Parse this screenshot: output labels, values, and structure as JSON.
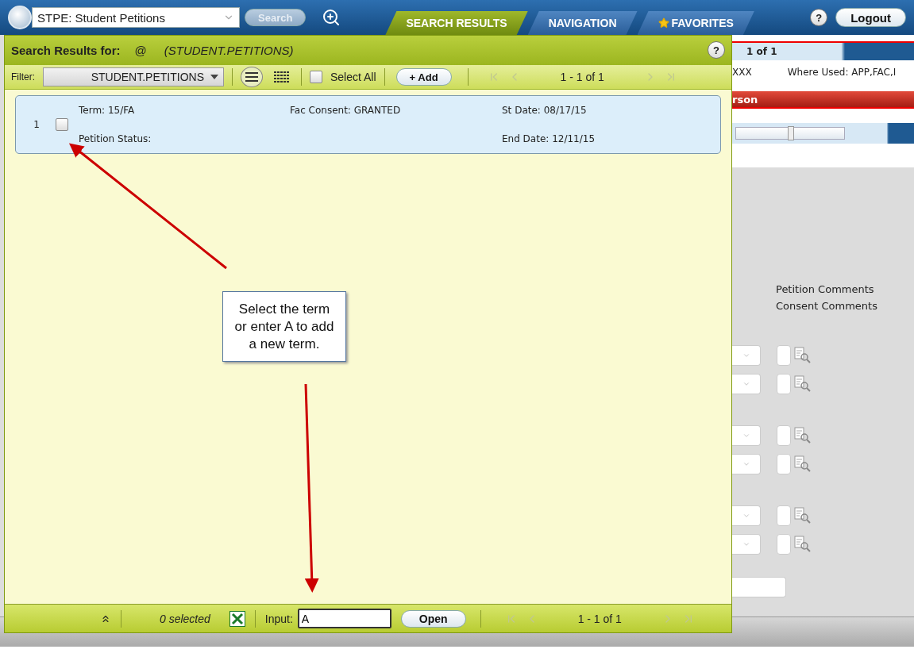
{
  "top_bar": {
    "module_field": {
      "value": "STPE: Student Petitions"
    },
    "search_button": "Search",
    "tabs": [
      {
        "label": "SEARCH RESULTS",
        "selected": true
      },
      {
        "label": "NAVIGATION",
        "selected": false
      },
      {
        "label": "FAVORITES",
        "selected": false
      }
    ],
    "help": "?",
    "logout": "Logout"
  },
  "results_panel": {
    "title": "Search Results for:",
    "query_symbol": "@",
    "query": "(STUDENT.PETITIONS)",
    "help": "?",
    "filter_label": "Filter:",
    "filter_value": "STUDENT.PETITIONS",
    "view_modes": [
      {
        "kind": "list",
        "selected": true
      },
      {
        "kind": "grid",
        "selected": false
      }
    ],
    "select_all": {
      "label": "Select All",
      "checked": false
    },
    "add_button": "+ Add",
    "pager": "1 - 1 of 1",
    "rows": [
      {
        "number": "1",
        "checked": false,
        "term": "Term: 15/FA",
        "fac_consent": "Fac Consent: GRANTED",
        "st_date": "St Date: 08/17/15",
        "petition_status": "Petition Status:",
        "end_date": "End Date: 12/11/15"
      }
    ],
    "footer": {
      "selected_count": "0 selected",
      "input_label": "Input:",
      "input_value": "A",
      "open_button": "Open",
      "pager": "1 - 1 of 1"
    }
  },
  "background_form": {
    "record_pager": "1 of 1",
    "column_1": "XXX",
    "where_used": "Where Used: APP,FAC,I",
    "person_bar": "rson",
    "slider": {
      "level": 0.5
    },
    "comment_headings": [
      "Petition Comments",
      "Consent Comments"
    ]
  },
  "annotation": {
    "callout": "Select the term or enter A to add a new term."
  }
}
